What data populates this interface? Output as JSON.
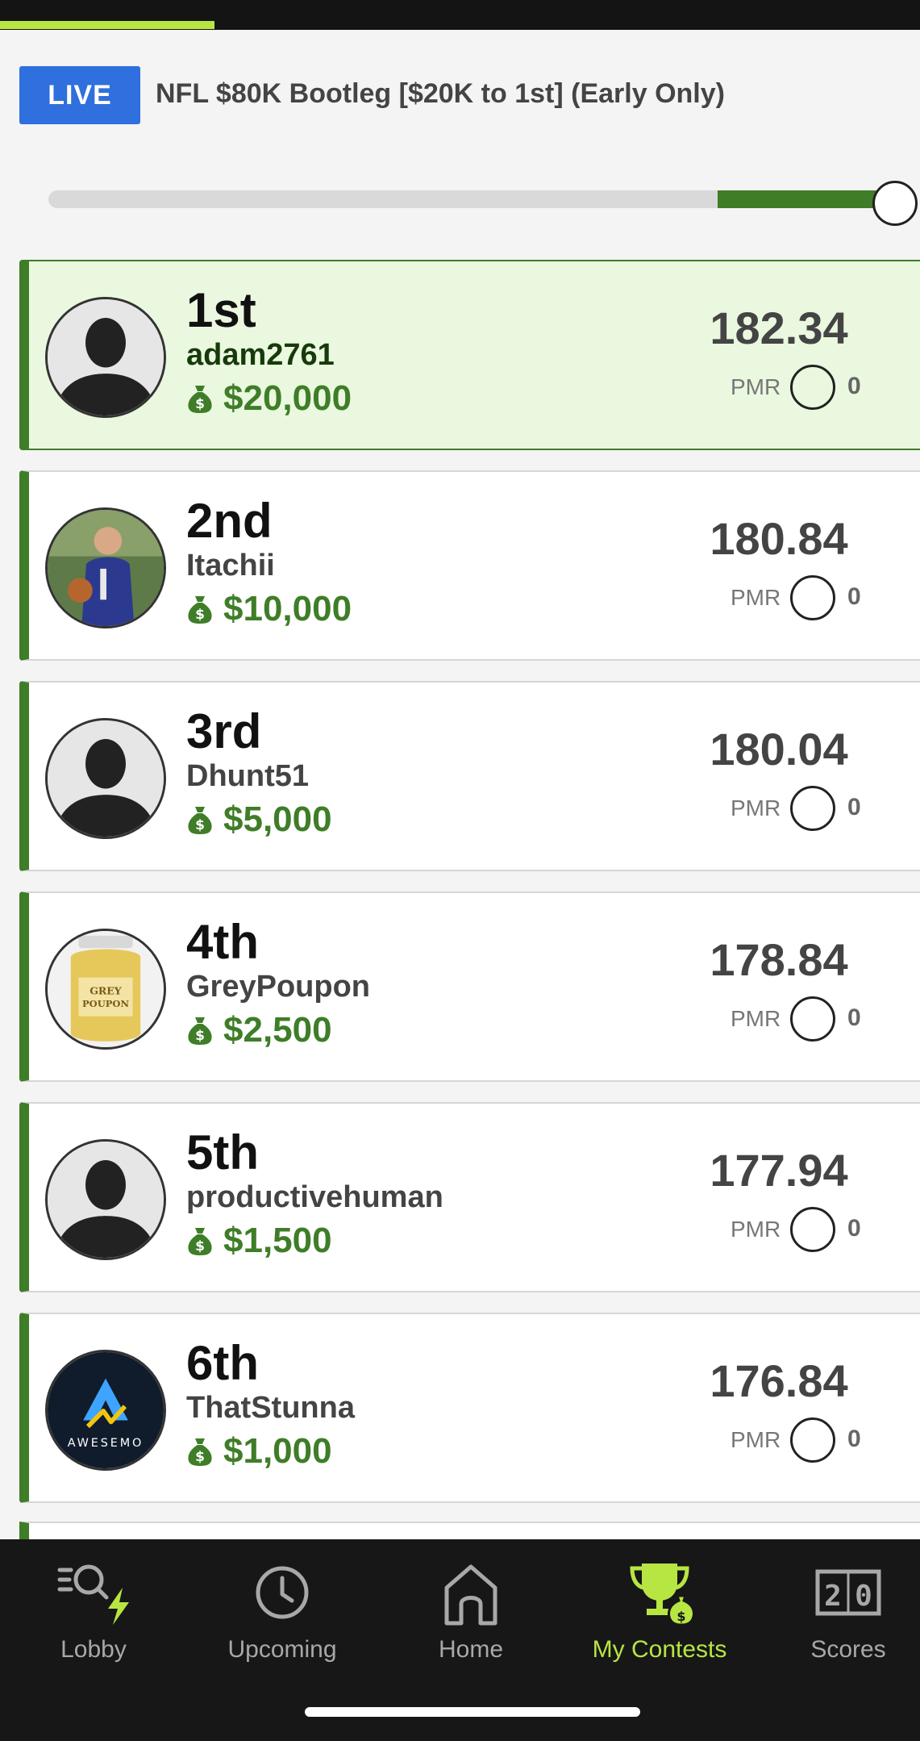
{
  "header": {
    "live_label": "LIVE",
    "contest_title": "NFL $80K Bootleg [$20K to 1st] (Early Only)",
    "progress_fraction": 0.21
  },
  "entries": [
    {
      "rank": "1st",
      "username": "adam2761",
      "prize": "$20,000",
      "score": "182.34",
      "pmr_label": "PMR",
      "pmr": "0",
      "avatar": "silhouette",
      "highlight": true
    },
    {
      "rank": "2nd",
      "username": "Itachii",
      "prize": "$10,000",
      "score": "180.84",
      "pmr_label": "PMR",
      "pmr": "0",
      "avatar": "photo-person"
    },
    {
      "rank": "3rd",
      "username": "Dhunt51",
      "prize": "$5,000",
      "score": "180.04",
      "pmr_label": "PMR",
      "pmr": "0",
      "avatar": "silhouette"
    },
    {
      "rank": "4th",
      "username": "GreyPoupon",
      "prize": "$2,500",
      "score": "178.84",
      "pmr_label": "PMR",
      "pmr": "0",
      "avatar": "photo-mustard-jar"
    },
    {
      "rank": "5th",
      "username": "productivehuman",
      "prize": "$1,500",
      "score": "177.94",
      "pmr_label": "PMR",
      "pmr": "0",
      "avatar": "silhouette"
    },
    {
      "rank": "6th",
      "username": "ThatStunna",
      "prize": "$1,000",
      "score": "176.84",
      "pmr_label": "PMR",
      "pmr": "0",
      "avatar": "awesemo-logo",
      "avatar_text": "AWESEMO"
    }
  ],
  "tabs": [
    {
      "label": "Lobby",
      "icon": "lobby-search-bolt-icon"
    },
    {
      "label": "Upcoming",
      "icon": "clock-icon"
    },
    {
      "label": "Home",
      "icon": "home-icon"
    },
    {
      "label": "My Contests",
      "icon": "trophy-money-icon",
      "active": true
    },
    {
      "label": "Scores",
      "icon": "scoreboard-icon"
    }
  ],
  "colors": {
    "live_blue": "#2f6fde",
    "accent_green": "#3f7d28",
    "active_tab": "#b7e642",
    "highlight_bg": "#eaf8df",
    "tabbar_bg": "#171717"
  }
}
